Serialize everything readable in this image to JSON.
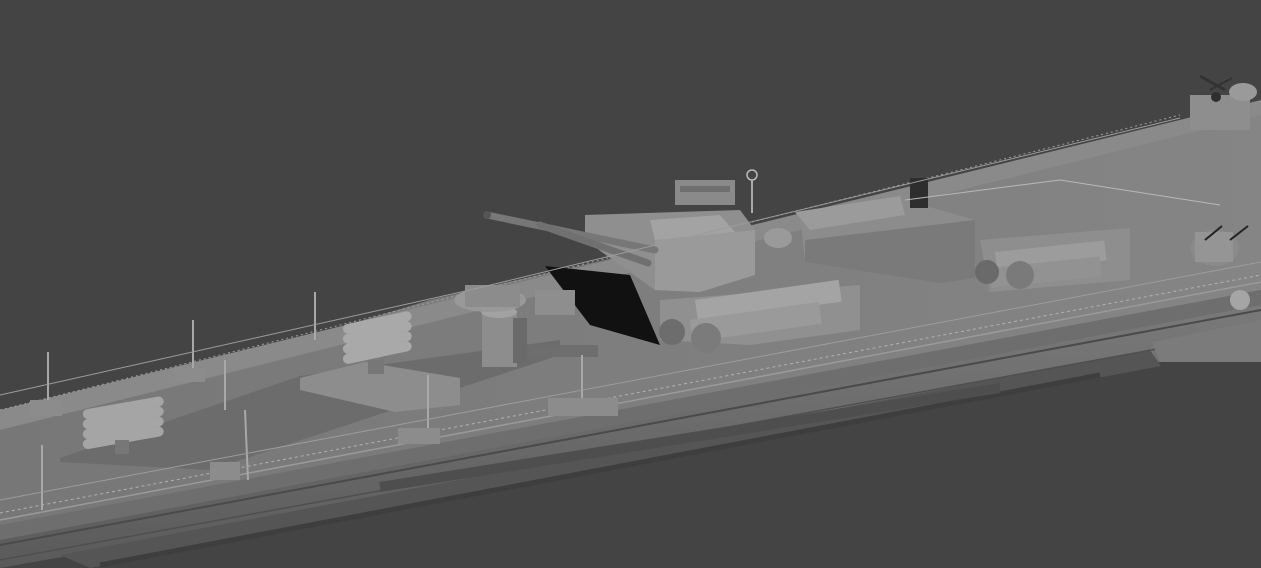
{
  "viewport": {
    "background_color": "#444444",
    "hull_color": "#8a8a8a",
    "deck_color": "#7e7e7e",
    "shadow_color": "#3a3a3a"
  },
  "scene": {
    "subject_icon": "ship-icon"
  }
}
